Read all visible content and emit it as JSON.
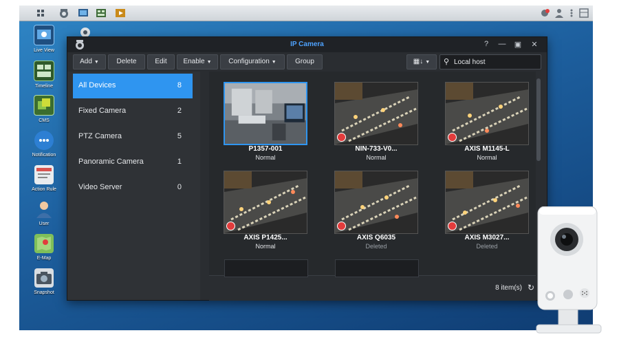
{
  "window": {
    "title": "IP Camera",
    "controls": [
      "?",
      "—",
      "▣",
      "✕"
    ]
  },
  "desktop_icons": [
    {
      "label": "Live View",
      "icon": "live-view-icon"
    },
    {
      "label": "Timeline",
      "icon": "timeline-icon"
    },
    {
      "label": "CMS",
      "icon": "cms-icon"
    },
    {
      "label": "Notification",
      "icon": "notification-icon"
    },
    {
      "label": "Action Rule",
      "icon": "action-rule-icon"
    },
    {
      "label": "User",
      "icon": "user-icon"
    },
    {
      "label": "E-Map",
      "icon": "emap-icon"
    },
    {
      "label": "Snapshot",
      "icon": "snapshot-icon"
    }
  ],
  "toolbar": {
    "add": "Add",
    "delete": "Delete",
    "edit": "Edit",
    "enable": "Enable",
    "configuration": "Configuration",
    "group": "Group",
    "search_placeholder": "Local host"
  },
  "sidebar": {
    "items": [
      {
        "label": "All Devices",
        "count": "8"
      },
      {
        "label": "Fixed Camera",
        "count": "2"
      },
      {
        "label": "PTZ Camera",
        "count": "5"
      },
      {
        "label": "Panoramic Camera",
        "count": "1"
      },
      {
        "label": "Video Server",
        "count": "0"
      }
    ]
  },
  "cameras": [
    {
      "name": "P1357-001",
      "status": "Normal"
    },
    {
      "name": "NIN-733-V0...",
      "status": "Normal"
    },
    {
      "name": "AXIS M1145-L",
      "status": "Normal"
    },
    {
      "name": "AXIS P1425...",
      "status": "Normal"
    },
    {
      "name": "AXIS Q6035",
      "status": "Deleted"
    },
    {
      "name": "AXIS M3027...",
      "status": "Deleted"
    }
  ],
  "footer": {
    "count": "8 item(s)"
  },
  "colors": {
    "accent": "#2f95f0",
    "title": "#4ea3ff",
    "record": "#e23c3c"
  }
}
